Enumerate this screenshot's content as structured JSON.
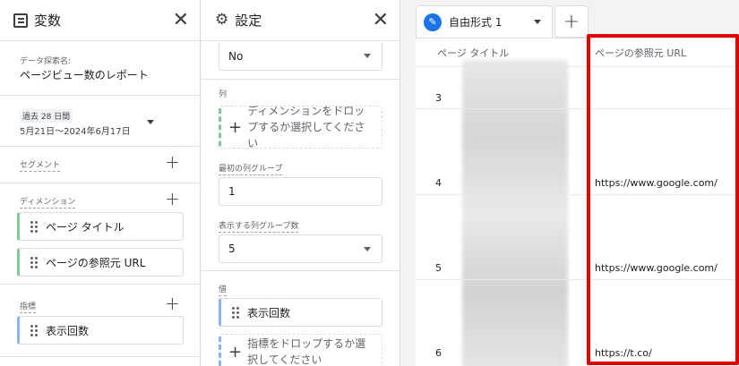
{
  "variables_panel": {
    "title": "変数",
    "exploration_name_label": "データ探索名:",
    "exploration_name": "ページビュー数のレポート",
    "date_chip": "過去 28 日間",
    "date_range": "5月21日～2024年6月17日",
    "segments_label": "セグメント",
    "dimensions_label": "ディメンション",
    "dimensions": [
      "ページ タイトル",
      "ページの参照元 URL"
    ],
    "metrics_label": "指標",
    "metrics": [
      "表示回数"
    ]
  },
  "settings_panel": {
    "title": "設定",
    "top_select_value": "No",
    "columns_label": "列",
    "columns_drop_text": "ディメンションをドロップするか選択してください",
    "first_column_group_label": "最初の列グループ",
    "first_column_group_value": "1",
    "show_column_groups_label": "表示する列グループ数",
    "show_column_groups_value": "5",
    "values_label": "値",
    "values_chip": "表示回数",
    "values_drop_text": "指標をドロップするか選択してください"
  },
  "canvas": {
    "tab_label": "自由形式 1",
    "columns": [
      "ページ タイトル",
      "ページの参照元 URL"
    ],
    "rows": [
      {
        "num": "3",
        "referrer": ""
      },
      {
        "num": "4",
        "referrer": "https://www.google.com/"
      },
      {
        "num": "5",
        "referrer": "https://www.google.com/"
      },
      {
        "num": "6",
        "referrer": "https://t.co/"
      }
    ],
    "highlight_color": "#e00000"
  },
  "colors": {
    "accent": "#1a73e8",
    "dimension": "#81c995",
    "metric": "#8ab4f8"
  }
}
